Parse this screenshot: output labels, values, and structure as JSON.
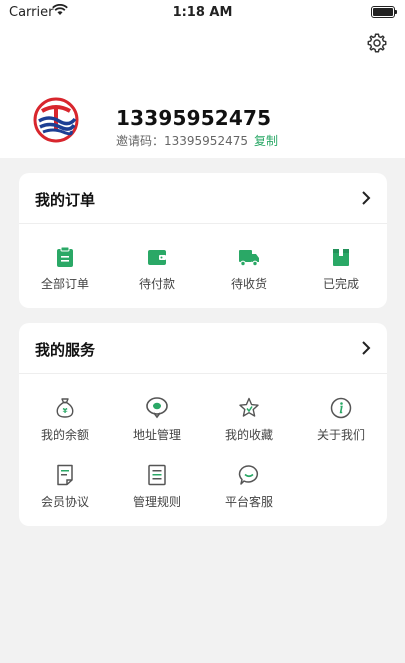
{
  "status_bar": {
    "carrier": "Carrier",
    "time": "1:18 AM"
  },
  "profile": {
    "phone": "13395952475",
    "invite_label": "邀请码：13395952475",
    "copy_label": "复制"
  },
  "orders": {
    "title": "我的订单",
    "items": [
      {
        "label": "全部订单",
        "icon": "clipboard-icon"
      },
      {
        "label": "待付款",
        "icon": "wallet-icon"
      },
      {
        "label": "待收货",
        "icon": "truck-icon"
      },
      {
        "label": "已完成",
        "icon": "box-icon"
      }
    ]
  },
  "services": {
    "title": "我的服务",
    "items": [
      {
        "label": "我的余额",
        "icon": "money-bag-icon"
      },
      {
        "label": "地址管理",
        "icon": "location-pin-icon"
      },
      {
        "label": "我的收藏",
        "icon": "star-icon"
      },
      {
        "label": "关于我们",
        "icon": "info-icon"
      },
      {
        "label": "会员协议",
        "icon": "document-icon"
      },
      {
        "label": "管理规则",
        "icon": "list-icon"
      },
      {
        "label": "平台客服",
        "icon": "chat-icon"
      }
    ]
  },
  "colors": {
    "accent": "#2aa866",
    "icon_gray": "#555555"
  }
}
